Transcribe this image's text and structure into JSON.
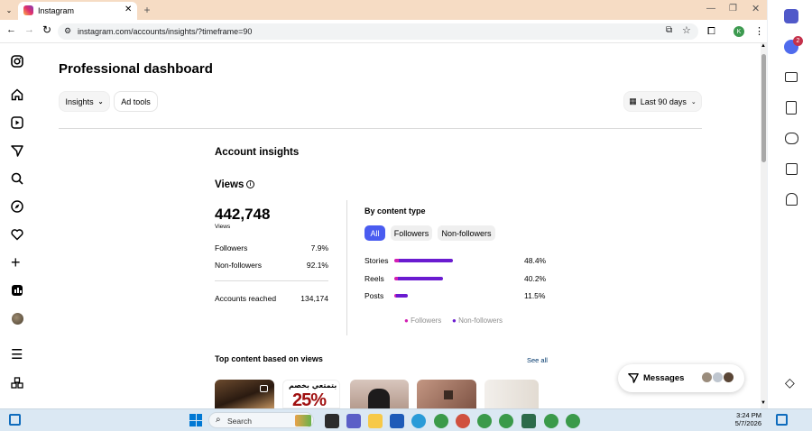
{
  "browser": {
    "tab_title": "Instagram",
    "url": "instagram.com/accounts/insights/?timeframe=90",
    "profile_initial": "K"
  },
  "page": {
    "title": "Professional dashboard",
    "insights_label": "Insights",
    "ad_tools_label": "Ad tools",
    "timeframe_label": "Last 90 days"
  },
  "account_insights": {
    "heading": "Account insights",
    "views_heading": "Views",
    "views_total": "442,748",
    "views_caption": "Views",
    "rows": [
      {
        "label": "Followers",
        "value": "7.9%"
      },
      {
        "label": "Non-followers",
        "value": "92.1%"
      }
    ],
    "accounts_reached_label": "Accounts reached",
    "accounts_reached_value": "134,174"
  },
  "content_type": {
    "heading": "By content type",
    "filters": [
      "All",
      "Followers",
      "Non-followers"
    ],
    "legend": [
      "Followers",
      "Non-followers"
    ],
    "colors": {
      "followers": "#d21fb3",
      "non_followers": "#6a1bd0",
      "active_chip": "#4a5cf0"
    }
  },
  "chart_data": {
    "type": "bar",
    "title": "By content type",
    "categories": [
      "Stories",
      "Reels",
      "Posts"
    ],
    "series": [
      {
        "name": "Followers",
        "values": [
          3.5,
          3.0,
          1.3
        ]
      },
      {
        "name": "Non-followers",
        "values": [
          44.9,
          37.2,
          10.2
        ]
      }
    ],
    "totals": [
      "48.4%",
      "40.2%",
      "11.5%"
    ]
  },
  "top_content": {
    "heading": "Top content based on views",
    "see_all": "See all",
    "thumb2_text": "25%",
    "thumb2_arabic": "بتمتعي بخصم"
  },
  "messages": {
    "label": "Messages"
  },
  "notifications": {
    "teams_badge": "2"
  },
  "taskbar": {
    "search_placeholder": "Search",
    "time": "3:24 PM",
    "date": "5/7/2026"
  }
}
